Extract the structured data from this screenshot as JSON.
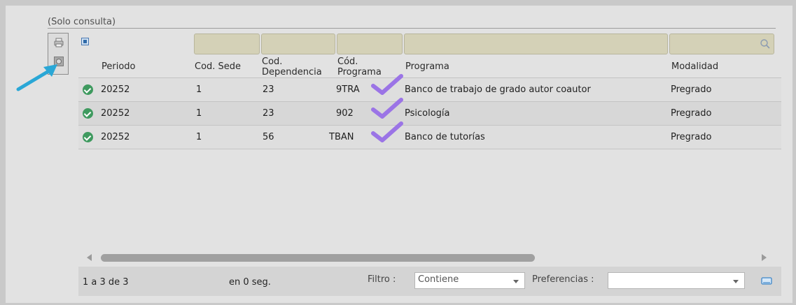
{
  "readonly_label": "(Solo consulta)",
  "columns": {
    "periodo": "Periodo",
    "cod_sede": "Cod. Sede",
    "cod_dependencia_line1": "Cod.",
    "cod_dependencia_line2": "Dependencia",
    "cod_programa_line1": "Cód.",
    "cod_programa_line2": "Programa",
    "programa": "Programa",
    "modalidad": "Modalidad"
  },
  "rows": [
    {
      "periodo": "20252",
      "cod_sede": "1",
      "cod_dependencia": "23",
      "cod_programa": "9TRA",
      "programa": "Banco de trabajo de grado autor coautor",
      "modalidad": "Pregrado"
    },
    {
      "periodo": "20252",
      "cod_sede": "1",
      "cod_dependencia": "23",
      "cod_programa": "902",
      "programa": "Psicología",
      "modalidad": "Pregrado"
    },
    {
      "periodo": "20252",
      "cod_sede": "1",
      "cod_dependencia": "56",
      "cod_programa": "TBAN",
      "programa": "Banco de tutorías",
      "modalidad": "Pregrado"
    }
  ],
  "footer": {
    "range": "1 a 3 de 3",
    "time": "en 0 seg.",
    "filter_label": "Filtro :",
    "filter_value": "Contiene",
    "preferences_label": "Preferencias :",
    "preferences_value": ""
  },
  "icons": {
    "print": "printer-icon",
    "settings": "settings-icon",
    "status": "check-circle-icon",
    "search": "search-icon",
    "export": "export-icon"
  },
  "colors": {
    "status_green": "#3f9a5f",
    "filter_bg": "#d4d1b7",
    "check_purple": "#9b74e6",
    "annotation_arrow": "#2aa7d6"
  }
}
